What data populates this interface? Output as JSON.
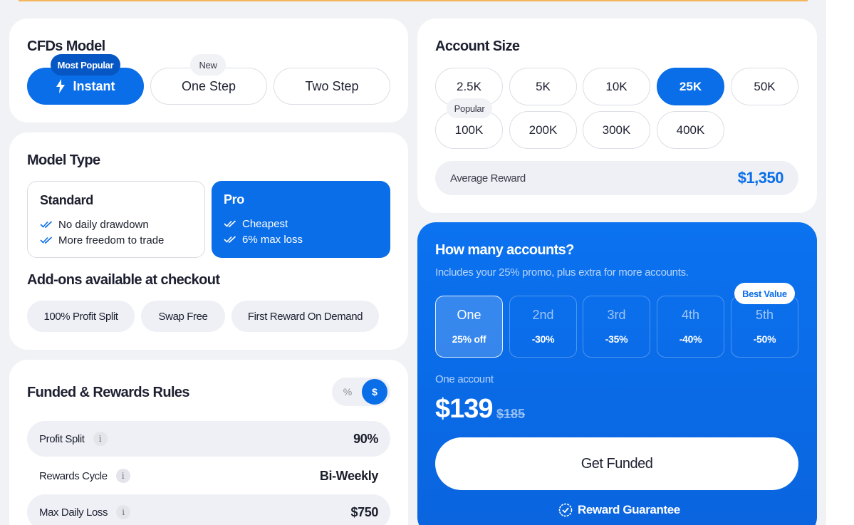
{
  "cfds_model": {
    "title": "CFDs Model",
    "options": [
      {
        "label": "Instant",
        "badge": "Most Popular",
        "active": true,
        "icon": "bolt-icon"
      },
      {
        "label": "One Step",
        "badge": "New",
        "active": false
      },
      {
        "label": "Two Step",
        "badge": "",
        "active": false
      }
    ]
  },
  "model_type": {
    "title": "Model Type",
    "standard": {
      "title": "Standard",
      "features": [
        "No daily drawdown",
        "More freedom to trade"
      ]
    },
    "pro": {
      "title": "Pro",
      "features": [
        "Cheapest",
        "6% max loss"
      ]
    },
    "addons_title": "Add-ons available at checkout",
    "addons": [
      "100% Profit Split",
      "Swap Free",
      "First Reward On Demand"
    ]
  },
  "rules": {
    "title": "Funded & Rewards Rules",
    "toggle": {
      "percent": "%",
      "dollar": "$"
    },
    "rows": [
      {
        "label": "Profit Split",
        "value": "90%"
      },
      {
        "label": "Rewards Cycle",
        "value": "Bi-Weekly"
      },
      {
        "label": "Max Daily Loss",
        "value": "$750"
      }
    ]
  },
  "account_size": {
    "title": "Account Size",
    "sizes": [
      "2.5K",
      "5K",
      "10K",
      "25K",
      "50K",
      "100K",
      "200K",
      "300K",
      "400K"
    ],
    "selected": "25K",
    "popular_badge": "Popular",
    "avg_label": "Average Reward",
    "avg_value": "$1,350"
  },
  "accounts": {
    "title": "How many accounts?",
    "subtitle": "Includes your 25% promo, plus extra for more accounts.",
    "best_value": "Best Value",
    "options": [
      {
        "name": "One",
        "discount": "25% off",
        "active": true
      },
      {
        "name": "2nd",
        "discount": "-30%",
        "active": false
      },
      {
        "name": "3rd",
        "discount": "-35%",
        "active": false
      },
      {
        "name": "4th",
        "discount": "-40%",
        "active": false
      },
      {
        "name": "5th",
        "discount": "-50%",
        "active": false
      }
    ],
    "one_account_label": "One account",
    "price": "$139",
    "old_price": "$185",
    "cta": "Get Funded",
    "guarantee": "Reward Guarantee"
  },
  "colors": {
    "primary": "#0a6ee8",
    "accent_line": "#f3b65d",
    "background": "#f1f2f6"
  }
}
